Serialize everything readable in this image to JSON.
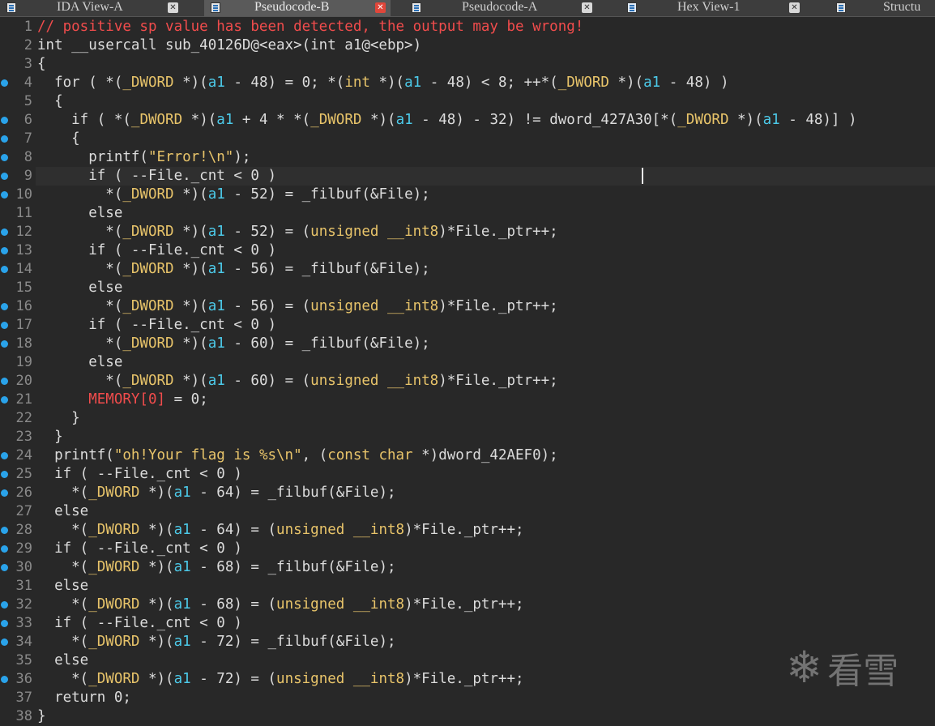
{
  "tabs": [
    {
      "label": "IDA View-A",
      "active": false,
      "icon": "ida-view-icon"
    },
    {
      "label": "Pseudocode-B",
      "active": true,
      "icon": "pseudocode-icon"
    },
    {
      "label": "Pseudocode-A",
      "active": false,
      "icon": "pseudocode-icon"
    },
    {
      "label": "Hex View-1",
      "active": false,
      "icon": "hex-view-icon"
    },
    {
      "label": "Structu",
      "active": false,
      "icon": "structures-icon"
    }
  ],
  "colors": {
    "background": "#282828",
    "breakpoint_dot": "#2aa3ea",
    "comment": "#f14c4c",
    "keyword": "#e8c46a",
    "variable": "#4cc9e8"
  },
  "code": {
    "lines": [
      {
        "n": "1",
        "dot": false,
        "tokens": [
          {
            "t": "// positive sp value has been detected, the output may be wrong!",
            "c": "comment"
          }
        ]
      },
      {
        "n": "2",
        "dot": false,
        "tokens": [
          {
            "t": "int __usercall sub_40126D@<eax>(int a1@<ebp>)",
            "c": ""
          }
        ]
      },
      {
        "n": "3",
        "dot": false,
        "tokens": [
          {
            "t": "{",
            "c": ""
          }
        ]
      },
      {
        "n": "4",
        "dot": true,
        "tokens": [
          {
            "t": "  for ( *(",
            "c": ""
          },
          {
            "t": "_DWORD",
            "c": "kw"
          },
          {
            "t": " *)(",
            "c": ""
          },
          {
            "t": "a1",
            "c": "var"
          },
          {
            "t": " - 48) = 0; *(",
            "c": ""
          },
          {
            "t": "int",
            "c": "kw"
          },
          {
            "t": " *)(",
            "c": ""
          },
          {
            "t": "a1",
            "c": "var"
          },
          {
            "t": " - 48) < 8; ++*(",
            "c": ""
          },
          {
            "t": "_DWORD",
            "c": "kw"
          },
          {
            "t": " *)(",
            "c": ""
          },
          {
            "t": "a1",
            "c": "var"
          },
          {
            "t": " - 48) )",
            "c": ""
          }
        ]
      },
      {
        "n": "5",
        "dot": false,
        "tokens": [
          {
            "t": "  {",
            "c": ""
          }
        ]
      },
      {
        "n": "6",
        "dot": true,
        "tokens": [
          {
            "t": "    if ( *(",
            "c": ""
          },
          {
            "t": "_DWORD",
            "c": "kw"
          },
          {
            "t": " *)(",
            "c": ""
          },
          {
            "t": "a1",
            "c": "var"
          },
          {
            "t": " + 4 * *(",
            "c": ""
          },
          {
            "t": "_DWORD",
            "c": "kw"
          },
          {
            "t": " *)(",
            "c": ""
          },
          {
            "t": "a1",
            "c": "var"
          },
          {
            "t": " - 48) - 32) != dword_427A30[*(",
            "c": ""
          },
          {
            "t": "_DWORD",
            "c": "kw"
          },
          {
            "t": " *)(",
            "c": ""
          },
          {
            "t": "a1",
            "c": "var"
          },
          {
            "t": " - 48)] )",
            "c": ""
          }
        ]
      },
      {
        "n": "7",
        "dot": true,
        "tokens": [
          {
            "t": "    {",
            "c": ""
          }
        ]
      },
      {
        "n": "8",
        "dot": true,
        "tokens": [
          {
            "t": "      printf(",
            "c": ""
          },
          {
            "t": "\"Error!\\n\"",
            "c": "str"
          },
          {
            "t": ");",
            "c": ""
          }
        ]
      },
      {
        "n": "9",
        "dot": true,
        "highlight": true,
        "tokens": [
          {
            "t": "      if ( --File._cnt < 0 )",
            "c": ""
          }
        ]
      },
      {
        "n": "10",
        "dot": true,
        "tokens": [
          {
            "t": "        *(",
            "c": ""
          },
          {
            "t": "_DWORD",
            "c": "kw"
          },
          {
            "t": " *)(",
            "c": ""
          },
          {
            "t": "a1",
            "c": "var"
          },
          {
            "t": " - 52) = _filbuf(&File);",
            "c": ""
          }
        ]
      },
      {
        "n": "11",
        "dot": false,
        "tokens": [
          {
            "t": "      else",
            "c": ""
          }
        ]
      },
      {
        "n": "12",
        "dot": true,
        "tokens": [
          {
            "t": "        *(",
            "c": ""
          },
          {
            "t": "_DWORD",
            "c": "kw"
          },
          {
            "t": " *)(",
            "c": ""
          },
          {
            "t": "a1",
            "c": "var"
          },
          {
            "t": " - 52) = (",
            "c": ""
          },
          {
            "t": "unsigned __int8",
            "c": "kw"
          },
          {
            "t": ")*File._ptr++;",
            "c": ""
          }
        ]
      },
      {
        "n": "13",
        "dot": true,
        "tokens": [
          {
            "t": "      if ( --File._cnt < 0 )",
            "c": ""
          }
        ]
      },
      {
        "n": "14",
        "dot": true,
        "tokens": [
          {
            "t": "        *(",
            "c": ""
          },
          {
            "t": "_DWORD",
            "c": "kw"
          },
          {
            "t": " *)(",
            "c": ""
          },
          {
            "t": "a1",
            "c": "var"
          },
          {
            "t": " - 56) = _filbuf(&File);",
            "c": ""
          }
        ]
      },
      {
        "n": "15",
        "dot": false,
        "tokens": [
          {
            "t": "      else",
            "c": ""
          }
        ]
      },
      {
        "n": "16",
        "dot": true,
        "tokens": [
          {
            "t": "        *(",
            "c": ""
          },
          {
            "t": "_DWORD",
            "c": "kw"
          },
          {
            "t": " *)(",
            "c": ""
          },
          {
            "t": "a1",
            "c": "var"
          },
          {
            "t": " - 56) = (",
            "c": ""
          },
          {
            "t": "unsigned __int8",
            "c": "kw"
          },
          {
            "t": ")*File._ptr++;",
            "c": ""
          }
        ]
      },
      {
        "n": "17",
        "dot": true,
        "tokens": [
          {
            "t": "      if ( --File._cnt < 0 )",
            "c": ""
          }
        ]
      },
      {
        "n": "18",
        "dot": true,
        "tokens": [
          {
            "t": "        *(",
            "c": ""
          },
          {
            "t": "_DWORD",
            "c": "kw"
          },
          {
            "t": " *)(",
            "c": ""
          },
          {
            "t": "a1",
            "c": "var"
          },
          {
            "t": " - 60) = _filbuf(&File);",
            "c": ""
          }
        ]
      },
      {
        "n": "19",
        "dot": false,
        "tokens": [
          {
            "t": "      else",
            "c": ""
          }
        ]
      },
      {
        "n": "20",
        "dot": true,
        "tokens": [
          {
            "t": "        *(",
            "c": ""
          },
          {
            "t": "_DWORD",
            "c": "kw"
          },
          {
            "t": " *)(",
            "c": ""
          },
          {
            "t": "a1",
            "c": "var"
          },
          {
            "t": " - 60) = (",
            "c": ""
          },
          {
            "t": "unsigned __int8",
            "c": "kw"
          },
          {
            "t": ")*File._ptr++;",
            "c": ""
          }
        ]
      },
      {
        "n": "21",
        "dot": true,
        "tokens": [
          {
            "t": "      ",
            "c": ""
          },
          {
            "t": "MEMORY[0]",
            "c": "red"
          },
          {
            "t": " = 0;",
            "c": ""
          }
        ]
      },
      {
        "n": "22",
        "dot": false,
        "tokens": [
          {
            "t": "    }",
            "c": ""
          }
        ]
      },
      {
        "n": "23",
        "dot": false,
        "tokens": [
          {
            "t": "  }",
            "c": ""
          }
        ]
      },
      {
        "n": "24",
        "dot": true,
        "tokens": [
          {
            "t": "  printf(",
            "c": ""
          },
          {
            "t": "\"oh!Your flag is %s\\n\"",
            "c": "str"
          },
          {
            "t": ", (",
            "c": ""
          },
          {
            "t": "const char",
            "c": "kw"
          },
          {
            "t": " *)dword_42AEF0);",
            "c": ""
          }
        ]
      },
      {
        "n": "25",
        "dot": true,
        "tokens": [
          {
            "t": "  if ( --File._cnt < 0 )",
            "c": ""
          }
        ]
      },
      {
        "n": "26",
        "dot": true,
        "tokens": [
          {
            "t": "    *(",
            "c": ""
          },
          {
            "t": "_DWORD",
            "c": "kw"
          },
          {
            "t": " *)(",
            "c": ""
          },
          {
            "t": "a1",
            "c": "var"
          },
          {
            "t": " - 64) = _filbuf(&File);",
            "c": ""
          }
        ]
      },
      {
        "n": "27",
        "dot": false,
        "tokens": [
          {
            "t": "  else",
            "c": ""
          }
        ]
      },
      {
        "n": "28",
        "dot": true,
        "tokens": [
          {
            "t": "    *(",
            "c": ""
          },
          {
            "t": "_DWORD",
            "c": "kw"
          },
          {
            "t": " *)(",
            "c": ""
          },
          {
            "t": "a1",
            "c": "var"
          },
          {
            "t": " - 64) = (",
            "c": ""
          },
          {
            "t": "unsigned __int8",
            "c": "kw"
          },
          {
            "t": ")*File._ptr++;",
            "c": ""
          }
        ]
      },
      {
        "n": "29",
        "dot": true,
        "tokens": [
          {
            "t": "  if ( --File._cnt < 0 )",
            "c": ""
          }
        ]
      },
      {
        "n": "30",
        "dot": true,
        "tokens": [
          {
            "t": "    *(",
            "c": ""
          },
          {
            "t": "_DWORD",
            "c": "kw"
          },
          {
            "t": " *)(",
            "c": ""
          },
          {
            "t": "a1",
            "c": "var"
          },
          {
            "t": " - 68) = _filbuf(&File);",
            "c": ""
          }
        ]
      },
      {
        "n": "31",
        "dot": false,
        "tokens": [
          {
            "t": "  else",
            "c": ""
          }
        ]
      },
      {
        "n": "32",
        "dot": true,
        "tokens": [
          {
            "t": "    *(",
            "c": ""
          },
          {
            "t": "_DWORD",
            "c": "kw"
          },
          {
            "t": " *)(",
            "c": ""
          },
          {
            "t": "a1",
            "c": "var"
          },
          {
            "t": " - 68) = (",
            "c": ""
          },
          {
            "t": "unsigned __int8",
            "c": "kw"
          },
          {
            "t": ")*File._ptr++;",
            "c": ""
          }
        ]
      },
      {
        "n": "33",
        "dot": true,
        "tokens": [
          {
            "t": "  if ( --File._cnt < 0 )",
            "c": ""
          }
        ]
      },
      {
        "n": "34",
        "dot": true,
        "tokens": [
          {
            "t": "    *(",
            "c": ""
          },
          {
            "t": "_DWORD",
            "c": "kw"
          },
          {
            "t": " *)(",
            "c": ""
          },
          {
            "t": "a1",
            "c": "var"
          },
          {
            "t": " - 72) = _filbuf(&File);",
            "c": ""
          }
        ]
      },
      {
        "n": "35",
        "dot": false,
        "tokens": [
          {
            "t": "  else",
            "c": ""
          }
        ]
      },
      {
        "n": "36",
        "dot": true,
        "tokens": [
          {
            "t": "    *(",
            "c": ""
          },
          {
            "t": "_DWORD",
            "c": "kw"
          },
          {
            "t": " *)(",
            "c": ""
          },
          {
            "t": "a1",
            "c": "var"
          },
          {
            "t": " - 72) = (",
            "c": ""
          },
          {
            "t": "unsigned __int8",
            "c": "kw"
          },
          {
            "t": ")*File._ptr++;",
            "c": ""
          }
        ]
      },
      {
        "n": "37",
        "dot": false,
        "tokens": [
          {
            "t": "  return 0;",
            "c": ""
          }
        ]
      },
      {
        "n": "38",
        "dot": false,
        "tokens": [
          {
            "t": "}",
            "c": ""
          }
        ]
      }
    ]
  },
  "watermark": {
    "symbol": "❄",
    "text": "看雪"
  }
}
